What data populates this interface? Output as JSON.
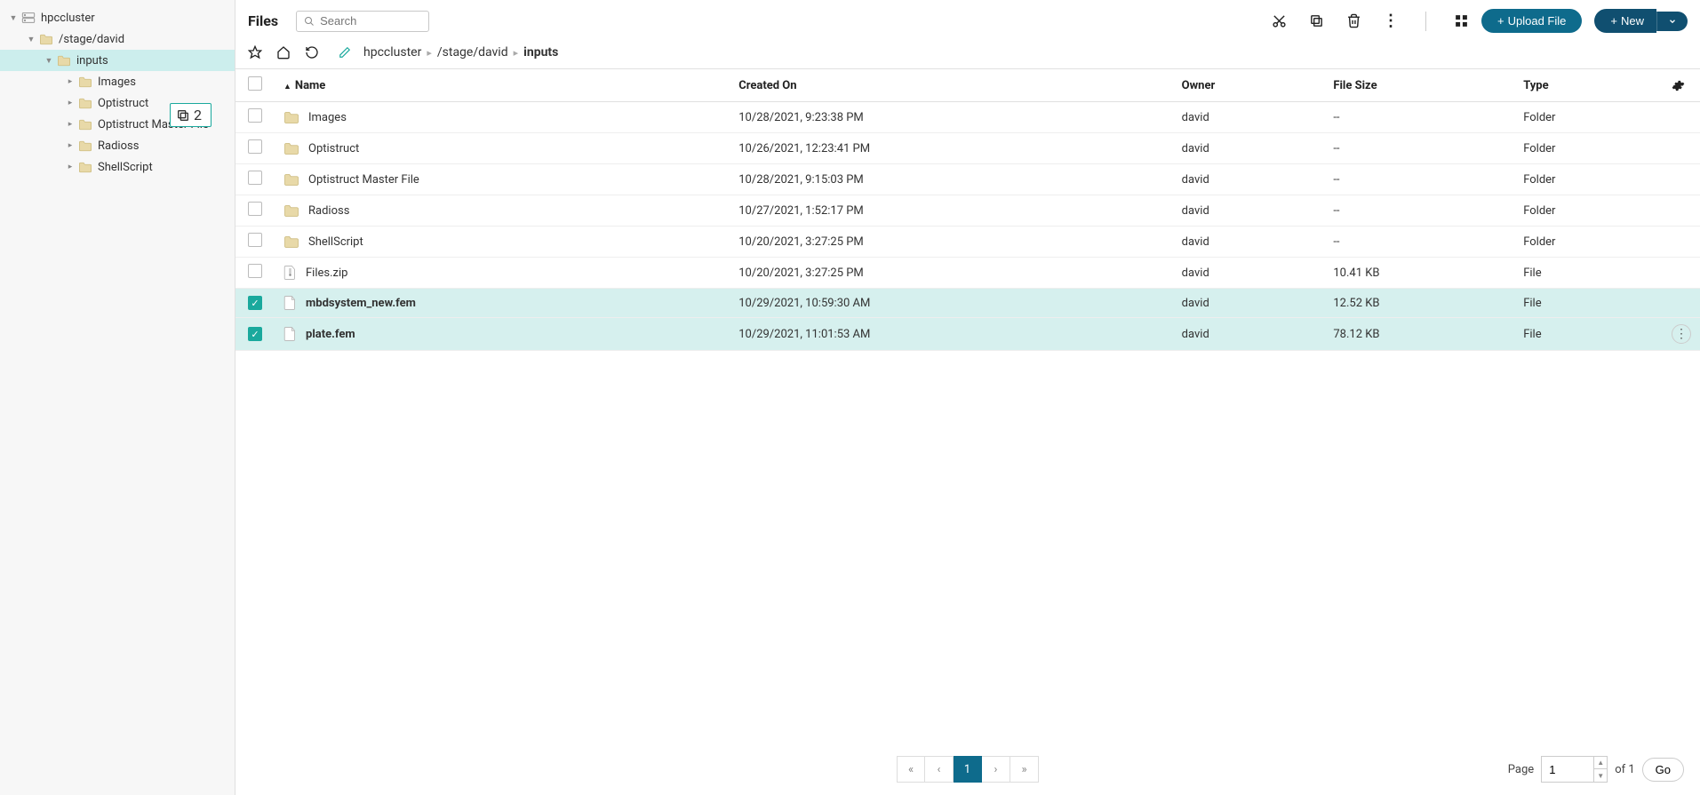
{
  "header": {
    "title": "Files",
    "search_placeholder": "Search",
    "upload_label": "Upload File",
    "new_label": "New"
  },
  "breadcrumb": {
    "segments": [
      "hpccluster",
      "/stage/david",
      "inputs"
    ]
  },
  "tree": {
    "root": "hpccluster",
    "items": [
      {
        "label": "/stage/david",
        "indent": 1,
        "expanded": true
      },
      {
        "label": "inputs",
        "indent": 2,
        "expanded": true,
        "selected": true
      },
      {
        "label": "Images",
        "indent": 3,
        "expanded": false
      },
      {
        "label": "Optistruct",
        "indent": 3,
        "expanded": false
      },
      {
        "label": "Optistruct Master File",
        "indent": 3,
        "expanded": false
      },
      {
        "label": "Radioss",
        "indent": 3,
        "expanded": false
      },
      {
        "label": "ShellScript",
        "indent": 3,
        "expanded": false
      }
    ]
  },
  "drag_badge": {
    "count": "2"
  },
  "table": {
    "columns": {
      "name": "Name",
      "created": "Created On",
      "owner": "Owner",
      "size": "File Size",
      "type": "Type"
    },
    "rows": [
      {
        "name": "Images",
        "created": "10/28/2021, 9:23:38 PM",
        "owner": "david",
        "size": "--",
        "type": "Folder",
        "kind": "folder",
        "selected": false
      },
      {
        "name": "Optistruct",
        "created": "10/26/2021, 12:23:41 PM",
        "owner": "david",
        "size": "--",
        "type": "Folder",
        "kind": "folder",
        "selected": false
      },
      {
        "name": "Optistruct Master File",
        "created": "10/28/2021, 9:15:03 PM",
        "owner": "david",
        "size": "--",
        "type": "Folder",
        "kind": "folder",
        "selected": false
      },
      {
        "name": "Radioss",
        "created": "10/27/2021, 1:52:17 PM",
        "owner": "david",
        "size": "--",
        "type": "Folder",
        "kind": "folder",
        "selected": false
      },
      {
        "name": "ShellScript",
        "created": "10/20/2021, 3:27:25 PM",
        "owner": "david",
        "size": "--",
        "type": "Folder",
        "kind": "folder",
        "selected": false
      },
      {
        "name": "Files.zip",
        "created": "10/20/2021, 3:27:25 PM",
        "owner": "david",
        "size": "10.41 KB",
        "type": "File",
        "kind": "zip",
        "selected": false
      },
      {
        "name": "mbdsystem_new.fem",
        "created": "10/29/2021, 10:59:30 AM",
        "owner": "david",
        "size": "12.52 KB",
        "type": "File",
        "kind": "file",
        "selected": true
      },
      {
        "name": "plate.fem",
        "created": "10/29/2021, 11:01:53 AM",
        "owner": "david",
        "size": "78.12 KB",
        "type": "File",
        "kind": "file",
        "selected": true,
        "hovered": true
      }
    ]
  },
  "pagination": {
    "page_label": "Page",
    "page_value": "1",
    "of_label": "of 1",
    "go_label": "Go",
    "buttons": [
      "«",
      "‹",
      "1",
      "›",
      "»"
    ],
    "active": "1"
  },
  "colors": {
    "accent": "#0e6b8c",
    "selection": "#d6f0ee",
    "teal": "#1aa99d"
  }
}
